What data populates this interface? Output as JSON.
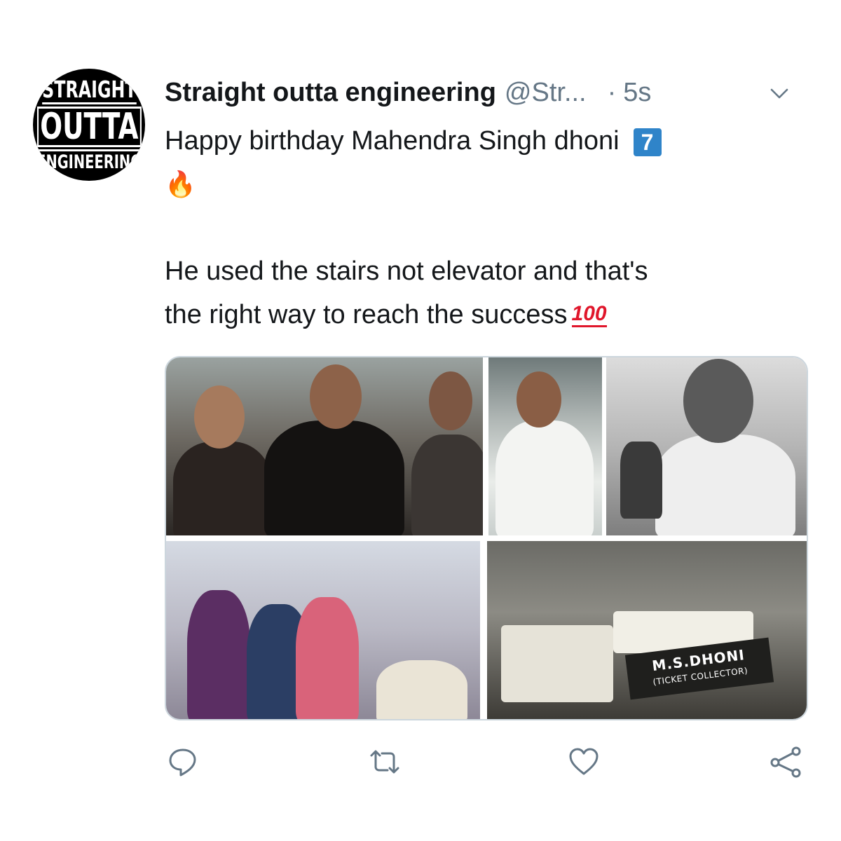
{
  "tweet": {
    "account_name": "Straight outta engineering",
    "handle": "@Str...",
    "separator": "·",
    "timestamp": "5s",
    "avatar_text": {
      "top": "STRAIGHT",
      "middle": "OUTTA",
      "bottom": "ENGINEERING"
    },
    "text_line1": "Happy birthday Mahendra Singh dhoni",
    "badge_emoji": "7",
    "fire_emoji": "🔥",
    "text_line2": "He used the stairs not elevator and that's",
    "text_line3": "the right way to reach the success",
    "hundred_emoji": "100"
  },
  "media": {
    "photo_count": 5,
    "nameplate_name": "M.S.DHONI",
    "nameplate_title": "(TICKET COLLECTOR)"
  },
  "icons": {
    "more": "chevron-down-icon",
    "reply": "reply-icon",
    "retweet": "retweet-icon",
    "like": "heart-icon",
    "share": "share-icon"
  },
  "colors": {
    "text_primary": "#14171a",
    "text_secondary": "#657786",
    "icon_gray": "#657786",
    "badge_blue": "#2f84c9",
    "emoji_red": "#e0162b",
    "border": "#ccd6dd"
  }
}
